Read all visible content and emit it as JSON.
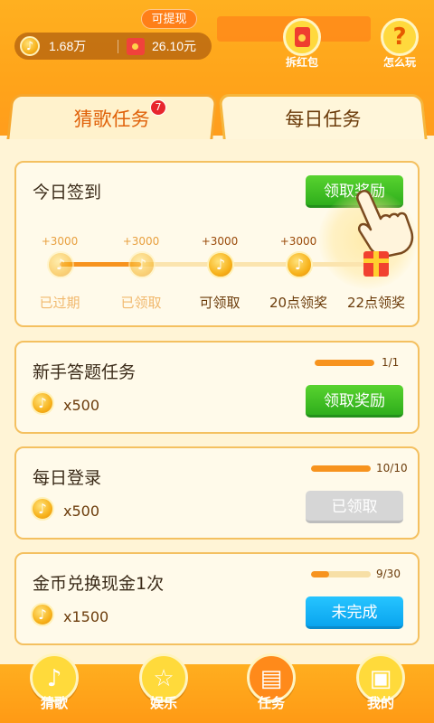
{
  "header": {
    "coin_balance": "1.68万",
    "cash_balance": "26.10元",
    "withdraw_label": "可提现",
    "red_packet_label": "拆红包",
    "help_label": "怎么玩",
    "help_glyph": "?"
  },
  "tabs": [
    {
      "label": "猜歌任务",
      "badge": "7"
    },
    {
      "label": "每日任务"
    }
  ],
  "checkin": {
    "title": "今日签到",
    "claim_label": "领取奖励",
    "steps": [
      {
        "bonus": "+3000",
        "label": "已过期"
      },
      {
        "bonus": "+3000",
        "label": "已领取"
      },
      {
        "bonus": "+3000",
        "label": "可领取"
      },
      {
        "bonus": "+3000",
        "label": "20点领奖"
      },
      {
        "bonus": "",
        "label": "22点领奖"
      }
    ]
  },
  "tasks": [
    {
      "title": "新手答题任务",
      "reward": "x500",
      "progress_text": "1/1",
      "progress": 1.0,
      "button": "领取奖励",
      "state": "claimable"
    },
    {
      "title": "每日登录",
      "reward": "x500",
      "progress_text": "10/10",
      "progress": 1.0,
      "button": "已领取",
      "state": "claimed"
    },
    {
      "title": "金币兑换现金1次",
      "reward": "x1500",
      "progress_text": "9/30",
      "progress": 0.3,
      "button": "未完成",
      "state": "incomplete"
    }
  ],
  "nav": [
    {
      "label": "猜歌",
      "glyph": "♪"
    },
    {
      "label": "娱乐",
      "glyph": "☆"
    },
    {
      "label": "任务",
      "glyph": "▤"
    },
    {
      "label": "我的",
      "glyph": "▣"
    }
  ],
  "colors": {
    "accent_orange": "#ff9d1c",
    "claim_green": "#2fae1c",
    "incomplete_blue": "#0aa5ef",
    "claimed_gray": "#d6d6d6"
  }
}
